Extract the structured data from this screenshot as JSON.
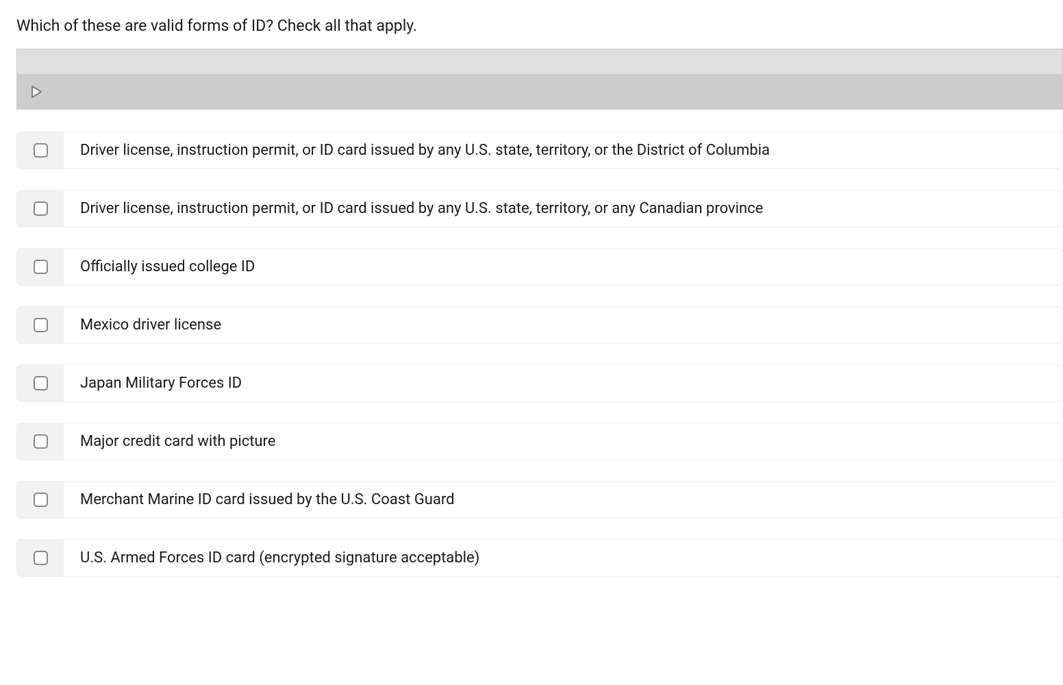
{
  "question": "Which of these are valid forms of ID? Check all that apply.",
  "options": [
    {
      "label": "Driver license, instruction permit, or ID card issued by any U.S. state, territory, or the District of Columbia"
    },
    {
      "label": "Driver license, instruction permit, or ID card issued by any U.S. state, territory, or any Canadian province"
    },
    {
      "label": "Officially issued college ID"
    },
    {
      "label": "Mexico driver license"
    },
    {
      "label": "Japan Military Forces ID"
    },
    {
      "label": "Major credit card with picture"
    },
    {
      "label": "Merchant Marine ID card issued by the U.S. Coast Guard"
    },
    {
      "label": "U.S. Armed Forces ID card (encrypted signature acceptable)"
    }
  ]
}
